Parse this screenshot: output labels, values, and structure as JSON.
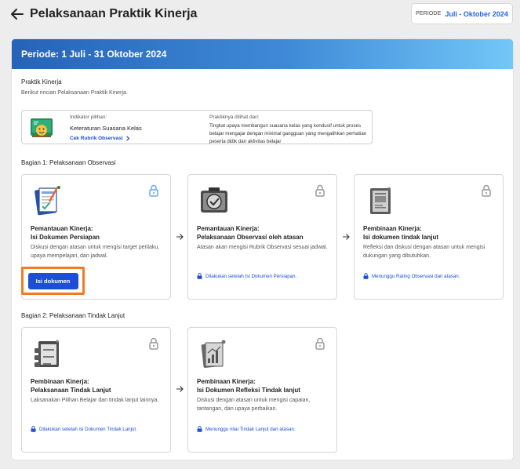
{
  "header": {
    "title": "Pelaksanaan Praktik Kinerja",
    "period_label": "PERIODE",
    "period_value": "Juli - Oktober 2024"
  },
  "banner": {
    "text": "Periode: 1 Juli - 31 Oktober 2024"
  },
  "practice": {
    "title": "Praktik Kinerja",
    "subtitle": "Berikut rincian Pelaksanaan Praktik Kinerja.",
    "indicator_caption": "Indikator pilihan:",
    "indicator_name": "Keteraturan Suasana Kelas",
    "rubric_link": "Cek Rubrik Observasi",
    "seen_caption": "Praktiknya dilihat dari:",
    "seen_text": "Tingkat upaya membangun suasana kelas yang kondusif untuk proses belajar mengajar dengan minimal gangguan yang mengalihkan perhatian peserta didik dari aktivitas belajar"
  },
  "section1": {
    "title": "Bagian 1: Pelaksanaan Observasi",
    "steps": [
      {
        "title1": "Pemantauan Kinerja:",
        "title2": "Isi Dokumen Persiapan",
        "desc": "Diskusi dengan atasan untuk mengisi target perilaku, upaya mempelajari, dan jadwal.",
        "button": "Isi dokumen"
      },
      {
        "title1": "Pemantauan Kinerja:",
        "title2": "Pelaksanaan Observasi oleh atasan",
        "desc": "Atasan akan mengisi Rubrik Observasi sesuai jadwal.",
        "note": "Dilakukan setelah Isi Dokumen Persiapan."
      },
      {
        "title1": "Pembinaan Kinerja:",
        "title2": "Isi dokumen tindak lanjut",
        "desc": "Refleksi dan diskusi dengan atasan untuk mengisi dukungan yang dibutuhkan.",
        "note": "Menunggu Rating Observasi dari atasan."
      }
    ]
  },
  "section2": {
    "title": "Bagian 2: Pelaksanaan Tindak Lanjut",
    "steps": [
      {
        "title1": "Pembinaan Kinerja:",
        "title2": "Pelaksanaan Tindak Lanjut",
        "desc": "Laksanakan Pilihan Belajar dan tindak lanjut lainnya.",
        "note": "Dilakukan setelah isi Dokumen Tindak Lanjut."
      },
      {
        "title1": "Pembinaan Kinerja:",
        "title2": "Isi Dokumen Refleksi Tindak lanjut",
        "desc": "Diskusi dengan atasan untuk mengisi capaian, tantangan, dan upaya perbaikan.",
        "note": "Menunggu nilai Tindak Lanjut dari atasan."
      }
    ]
  },
  "colors": {
    "accent": "#1d4ed8",
    "highlight": "#f47a20",
    "banner_start": "#2563b8",
    "banner_end": "#72c7f7"
  },
  "icons": [
    "back-arrow-icon",
    "classroom-icon",
    "chevron-right-icon",
    "document-checklist-icon",
    "observation-icon",
    "followup-document-icon",
    "checklist-clipboard-icon",
    "reflection-chart-icon",
    "lock-icon",
    "arrow-right-icon"
  ]
}
